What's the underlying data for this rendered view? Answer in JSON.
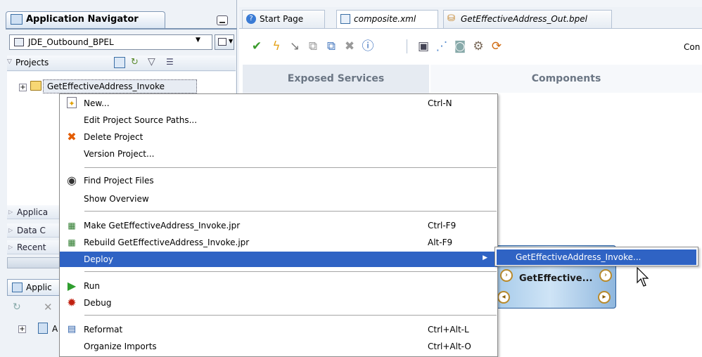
{
  "navigator": {
    "title": "Application Navigator",
    "application": "JDE_Outbound_BPEL",
    "projects_label": "Projects",
    "project": "GetEffectiveAddress_Invoke",
    "sections": [
      "Applica",
      "Data C",
      "Recent"
    ],
    "resources_tab": "Applic",
    "resources_tree_item": "A"
  },
  "editor": {
    "tabs": [
      {
        "label": "Start Page",
        "icon": "help-icon",
        "active": false
      },
      {
        "label": "composite.xml",
        "icon": "composite-icon",
        "active": true
      },
      {
        "label": "GetEffectiveAddress_Out.bpel",
        "icon": "bpel-icon",
        "active": false
      }
    ],
    "toolbar_truncated_label": "Con",
    "exposed_services": "Exposed Services",
    "components": "Components",
    "component_title": "GetEffective..."
  },
  "context_menu": {
    "items": [
      {
        "label": "New...",
        "shortcut": "Ctrl-N",
        "icon": "new-icon"
      },
      {
        "label": "Edit Project Source Paths...",
        "shortcut": "",
        "icon": ""
      },
      {
        "label": "Delete Project",
        "shortcut": "",
        "icon": "delete-icon"
      },
      {
        "label": "Version Project...",
        "shortcut": "",
        "icon": ""
      },
      {
        "label": "Find Project Files",
        "shortcut": "",
        "icon": "binoculars-icon"
      },
      {
        "label": "Show Overview",
        "shortcut": "",
        "icon": ""
      },
      {
        "label": "Make GetEffectiveAddress_Invoke.jpr",
        "shortcut": "Ctrl-F9",
        "icon": "make-icon"
      },
      {
        "label": "Rebuild GetEffectiveAddress_Invoke.jpr",
        "shortcut": "Alt-F9",
        "icon": "rebuild-icon"
      },
      {
        "label": "Deploy",
        "shortcut": "",
        "icon": ""
      },
      {
        "label": "Run",
        "shortcut": "",
        "icon": "run-icon"
      },
      {
        "label": "Debug",
        "shortcut": "",
        "icon": "debug-icon"
      },
      {
        "label": "Reformat",
        "shortcut": "Ctrl+Alt-L",
        "icon": "reformat-icon"
      },
      {
        "label": "Organize Imports",
        "shortcut": "Ctrl+Alt-O",
        "icon": ""
      }
    ],
    "selected": "Deploy",
    "submenu_item": "GetEffectiveAddress_Invoke..."
  },
  "colors": {
    "selection": "#2f63c4",
    "component_border": "#2d5f9d"
  }
}
